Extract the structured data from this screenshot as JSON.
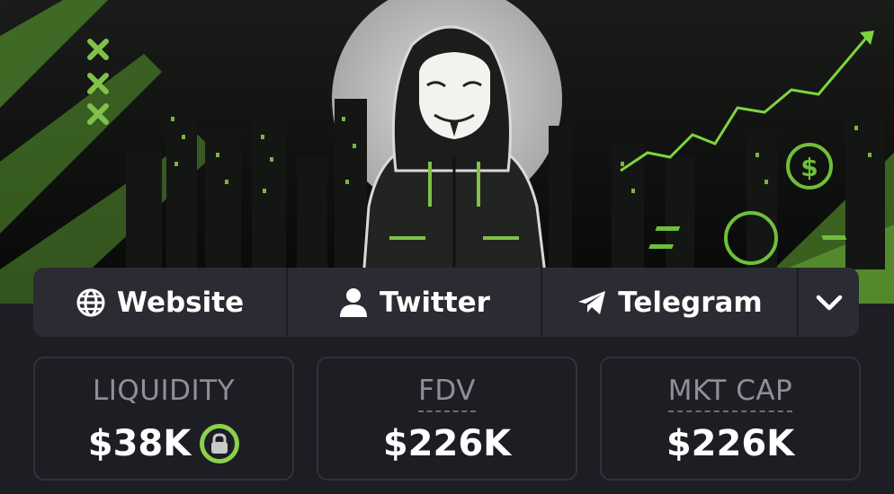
{
  "links": [
    {
      "label": "Website",
      "icon": "globe-icon"
    },
    {
      "label": "Twitter",
      "icon": "user-icon"
    },
    {
      "label": "Telegram",
      "icon": "telegram-icon"
    }
  ],
  "more_icon": "chevron-down-icon",
  "stats": {
    "liquidity": {
      "label": "LIQUIDITY",
      "value": "$38K",
      "locked": true
    },
    "fdv": {
      "label": "FDV",
      "value": "$226K"
    },
    "mkt_cap": {
      "label": "MKT CAP",
      "value": "$226K"
    }
  },
  "colors": {
    "accent_green": "#8bd14c",
    "panel": "#2b2c33",
    "background": "#1d1e24"
  }
}
